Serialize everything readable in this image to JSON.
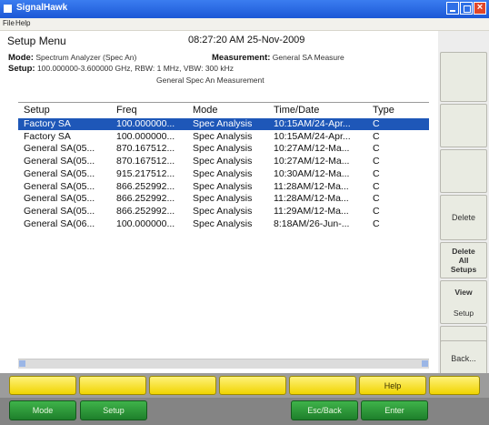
{
  "window": {
    "title": "SignalHawk"
  },
  "menu": [
    "File",
    "Help"
  ],
  "header": {
    "title": "Setup Menu",
    "datetime": "08:27:20 AM 25-Nov-2009",
    "mode_label": "Mode:",
    "mode_value": "Spectrum Analyzer (Spec An)",
    "measurement_label": "Measurement:",
    "measurement_value": "General SA Measure",
    "setup_label": "Setup:",
    "setup_value": "100.000000-3.600000 GHz, RBW: 1 MHz, VBW: 300 kHz",
    "setup_name": "General Spec An Measurement"
  },
  "table": {
    "columns": [
      "Setup",
      "Freq",
      "Mode",
      "Time/Date",
      "Type"
    ],
    "rows": [
      [
        "Factory SA",
        "100.000000...",
        "Spec Analysis",
        "10:15AM/24-Apr...",
        "C"
      ],
      [
        "Factory SA",
        "100.000000...",
        "Spec Analysis",
        "10:15AM/24-Apr...",
        "C"
      ],
      [
        "General SA(05...",
        "870.167512...",
        "Spec Analysis",
        "10:27AM/12-Ma...",
        "C"
      ],
      [
        "General SA(05...",
        "870.167512...",
        "Spec Analysis",
        "10:27AM/12-Ma...",
        "C"
      ],
      [
        "General SA(05...",
        "915.217512...",
        "Spec Analysis",
        "10:30AM/12-Ma...",
        "C"
      ],
      [
        "General SA(05...",
        "866.252992...",
        "Spec Analysis",
        "11:28AM/12-Ma...",
        "C"
      ],
      [
        "General SA(05...",
        "866.252992...",
        "Spec Analysis",
        "11:28AM/12-Ma...",
        "C"
      ],
      [
        "General SA(05...",
        "866.252992...",
        "Spec Analysis",
        "11:29AM/12-Ma...",
        "C"
      ],
      [
        "General SA(06...",
        "100.000000...",
        "Spec Analysis",
        "8:18AM/26-Jun-...",
        "C"
      ]
    ],
    "selected_index": 0
  },
  "sidebar": {
    "delete": "Delete",
    "delete_all": [
      "Delete",
      "All",
      "Setups"
    ],
    "view_setup": [
      "View",
      "Setup"
    ],
    "back": "Back..."
  },
  "softkeys": [
    "",
    "",
    "",
    "",
    "",
    "Help",
    ""
  ],
  "bottom": {
    "mode": "Mode",
    "setup": "Setup",
    "esc_back": "Esc/Back",
    "enter": "Enter"
  },
  "colors": {
    "selection": "#1e57b8",
    "softkey_yellow": "#f5e23a",
    "bottom_green": "#2a9a38"
  }
}
